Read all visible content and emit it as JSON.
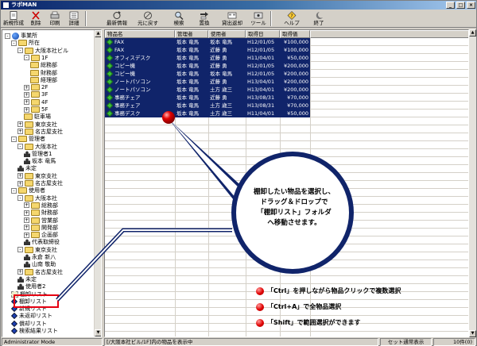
{
  "window": {
    "title": "ラボMAN"
  },
  "toolbar": [
    {
      "label": "新規作成",
      "icon": "new-document-icon"
    },
    {
      "label": "削除",
      "icon": "delete-icon"
    },
    {
      "label": "印刷",
      "icon": "print-icon"
    },
    {
      "label": "詳細",
      "icon": "details-icon"
    },
    {
      "label": "最新情報",
      "icon": "refresh-icon"
    },
    {
      "label": "元に戻す",
      "icon": "undo-icon"
    },
    {
      "label": "検索",
      "icon": "search-icon"
    },
    {
      "label": "置換",
      "icon": "replace-icon"
    },
    {
      "label": "貸出返却",
      "icon": "lend-return-icon"
    },
    {
      "label": "ツール",
      "icon": "tools-icon"
    },
    {
      "label": "ヘルプ",
      "icon": "help-icon"
    },
    {
      "label": "終了",
      "icon": "exit-icon"
    }
  ],
  "tree": [
    {
      "label": "事業所",
      "icon": "globe",
      "toggle": "-"
    },
    {
      "label": "所在",
      "icon": "folder",
      "toggle": "-"
    },
    {
      "label": "大阪本社ビル",
      "icon": "folder",
      "toggle": "-"
    },
    {
      "label": "1F",
      "icon": "folder",
      "toggle": "-"
    },
    {
      "label": "総務部",
      "icon": "folder",
      "toggle": ""
    },
    {
      "label": "財務部",
      "icon": "folder",
      "toggle": ""
    },
    {
      "label": "経理部",
      "icon": "folder",
      "toggle": ""
    },
    {
      "label": "2F",
      "icon": "folder",
      "toggle": "+"
    },
    {
      "label": "3F",
      "icon": "folder",
      "toggle": "+"
    },
    {
      "label": "4F",
      "icon": "folder",
      "toggle": "+"
    },
    {
      "label": "5F",
      "icon": "folder",
      "toggle": "+"
    },
    {
      "label": "駐車場",
      "icon": "folder",
      "toggle": ""
    },
    {
      "label": "東京支社",
      "icon": "folder",
      "toggle": "+"
    },
    {
      "label": "名古屋支社",
      "icon": "folder",
      "toggle": "+"
    },
    {
      "label": "管理者",
      "icon": "folder",
      "toggle": "-"
    },
    {
      "label": "大阪本社",
      "icon": "folder",
      "toggle": "-"
    },
    {
      "label": "管理者1",
      "icon": "person",
      "toggle": ""
    },
    {
      "label": "坂本 竜馬",
      "icon": "person",
      "toggle": ""
    },
    {
      "label": "未定",
      "icon": "person",
      "toggle": ""
    },
    {
      "label": "東京支社",
      "icon": "folder",
      "toggle": "+"
    },
    {
      "label": "名古屋支社",
      "icon": "folder",
      "toggle": "+"
    },
    {
      "label": "使用者",
      "icon": "folder",
      "toggle": "-"
    },
    {
      "label": "大阪本社",
      "icon": "folder",
      "toggle": "-"
    },
    {
      "label": "総務部",
      "icon": "folder",
      "toggle": "+"
    },
    {
      "label": "財務部",
      "icon": "folder",
      "toggle": "+"
    },
    {
      "label": "営業部",
      "icon": "folder",
      "toggle": "+"
    },
    {
      "label": "開発部",
      "icon": "folder",
      "toggle": "+"
    },
    {
      "label": "企画部",
      "icon": "folder",
      "toggle": "+"
    },
    {
      "label": "代表取締役",
      "icon": "person",
      "toggle": ""
    },
    {
      "label": "東京支社",
      "icon": "folder",
      "toggle": "-"
    },
    {
      "label": "永倉 新八",
      "icon": "person",
      "toggle": ""
    },
    {
      "label": "山南 敬助",
      "icon": "person",
      "toggle": ""
    },
    {
      "label": "名古屋支社",
      "icon": "folder",
      "toggle": "+"
    },
    {
      "label": "未定",
      "icon": "person",
      "toggle": ""
    },
    {
      "label": "使用者2",
      "icon": "person",
      "toggle": ""
    },
    {
      "label": "棚卸リスト",
      "icon": "gear",
      "toggle": ""
    },
    {
      "label": "棚卸リスト",
      "icon": "list",
      "toggle": ""
    },
    {
      "label": "新規リスト",
      "icon": "list",
      "toggle": ""
    },
    {
      "label": "未返却リスト",
      "icon": "list",
      "toggle": ""
    },
    {
      "label": "償却リスト",
      "icon": "list",
      "toggle": ""
    },
    {
      "label": "検索結果リスト",
      "icon": "list",
      "toggle": ""
    }
  ],
  "list": {
    "columns": [
      "物品名",
      "管理者",
      "使用者",
      "取得日",
      "取得価"
    ],
    "rows": [
      [
        "FAX",
        "坂本 竜馬",
        "坂本 竜馬",
        "H12/01/05",
        "¥100,000"
      ],
      [
        "FAX",
        "坂本 竜馬",
        "近藤 勇",
        "H12/01/05",
        "¥100,000"
      ],
      [
        "オフィスデスク",
        "坂本 竜馬",
        "近藤 勇",
        "H11/04/01",
        "¥50,000"
      ],
      [
        "コピー機",
        "坂本 竜馬",
        "近藤 勇",
        "H12/01/05",
        "¥200,000"
      ],
      [
        "コピー機",
        "坂本 竜馬",
        "坂本 竜馬",
        "H12/01/05",
        "¥200,000"
      ],
      [
        "ノートパソコン",
        "坂本 竜馬",
        "近藤 勇",
        "H13/04/01",
        "¥200,000"
      ],
      [
        "ノートパソコン",
        "坂本 竜馬",
        "土方 歳三",
        "H13/04/01",
        "¥200,000"
      ],
      [
        "事務チェア",
        "坂本 竜馬",
        "近藤 勇",
        "H13/08/31",
        "¥70,000"
      ],
      [
        "事務チェア",
        "坂本 竜馬",
        "土方 歳三",
        "H13/08/31",
        "¥70,000"
      ],
      [
        "事務デスク",
        "坂本 竜馬",
        "土方 歳三",
        "H11/04/01",
        "¥50,000"
      ]
    ]
  },
  "status": {
    "mode": "Administrator Mode",
    "message": "[/大阪本社ビル/1F]内の物品を表示中",
    "display_mode": "セット通常表示",
    "count": "10件(0)"
  },
  "callout": {
    "line1": "棚卸したい物品を選択し、",
    "line2": "ドラッグ＆ドロップで",
    "line3": "「棚卸リスト」フォルダ",
    "line4": "へ移動させます。"
  },
  "tips": [
    "「Ctrl」を押しながら物品クリックで複数選択",
    "「Ctrl+A」で全物品選択",
    "「Shift」で範囲選択ができます"
  ],
  "colors": {
    "selection": "#10246a",
    "highlight_box": "#e60012",
    "callout_border": "#10246a"
  }
}
